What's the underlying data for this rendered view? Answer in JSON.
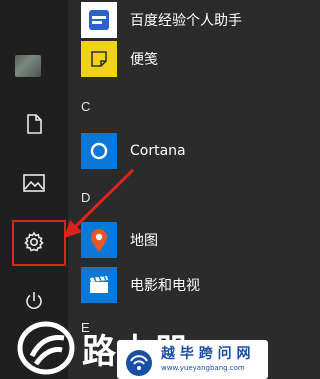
{
  "rail": {
    "items": [
      {
        "name": "user-avatar"
      },
      {
        "name": "documents",
        "icon": "document-icon"
      },
      {
        "name": "pictures",
        "icon": "picture-icon"
      },
      {
        "name": "settings",
        "icon": "gear-icon"
      },
      {
        "name": "power",
        "icon": "power-icon"
      }
    ]
  },
  "app_list": {
    "items_top": [
      {
        "label": "百度经验个人助手",
        "icon": "baidu-assistant-icon",
        "tile_color": "#ffffff"
      },
      {
        "label": "便笺",
        "icon": "sticky-notes-icon",
        "tile_color": "#f1d21a"
      }
    ],
    "section_c": "C",
    "cortana": {
      "label": "Cortana",
      "icon": "cortana-icon",
      "tile_color": "#0a78d7"
    },
    "section_d": "D",
    "items_d": [
      {
        "label": "地图",
        "icon": "maps-icon",
        "tile_color": "#0a78d7"
      },
      {
        "label": "电影和电视",
        "icon": "movies-tv-icon",
        "tile_color": "#0a78d7"
      }
    ],
    "section_e": "E"
  },
  "annotation": {
    "highlight_color": "#e0221f"
  },
  "watermark": {
    "big_text": "路由器",
    "site_name": "越 毕 跨 问 网",
    "site_url": "www.yueyangbang.com"
  }
}
